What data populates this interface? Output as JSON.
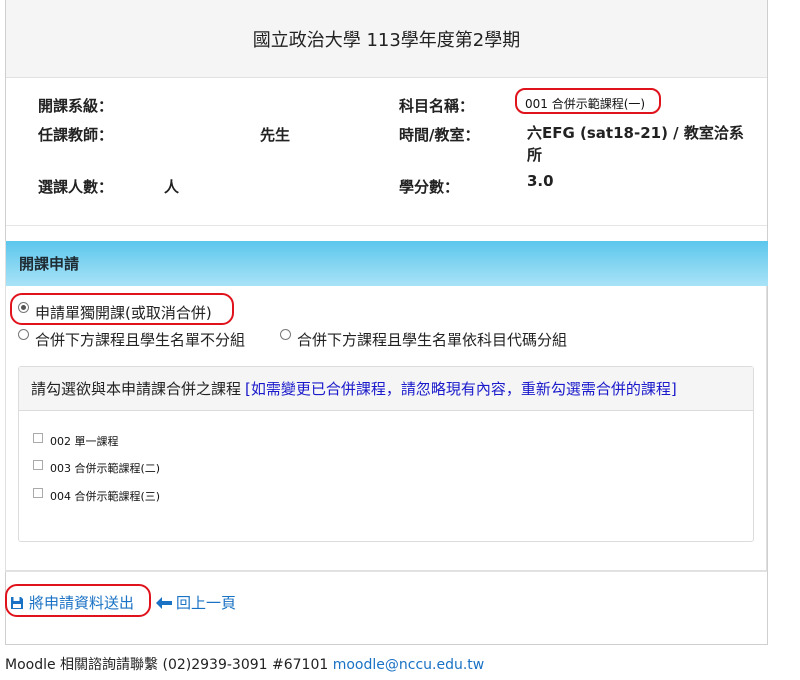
{
  "header": {
    "title": "國立政治大學 113學年度第2學期"
  },
  "info": {
    "department_label": "開課系級：",
    "department_value": "",
    "course_name_label": "科目名稱：",
    "course_name_value": "001 合併示範課程(一)",
    "teacher_label": "任課教師：",
    "teacher_value": "先生",
    "time_room_label": "時間/教室：",
    "time_room_value": "六EFG (sat18-21) / 教室洽系所",
    "enrollment_label": "選課人數：",
    "enrollment_value": "人",
    "credits_label": "學分數：",
    "credits_value": "3.0"
  },
  "apply_panel": {
    "heading": "開課申請",
    "options": [
      {
        "label": "申請單獨開課(或取消合併)",
        "checked": true
      },
      {
        "label": "合併下方課程且學生名單不分組",
        "checked": false
      },
      {
        "label": "合併下方課程且學生名單依科目代碼分組",
        "checked": false
      }
    ]
  },
  "merge_box": {
    "heading": "請勾選欲與本申請課合併之課程",
    "note": "[如需變更已合併課程，請忽略現有內容，重新勾選需合併的課程]",
    "courses": [
      {
        "label": "002 單一課程",
        "checked": false
      },
      {
        "label": "003 合併示範課程(二)",
        "checked": false
      },
      {
        "label": "004 合併示範課程(三)",
        "checked": false
      }
    ]
  },
  "actions": {
    "submit_label": "將申請資料送出",
    "back_label": "回上一頁"
  },
  "footer": {
    "text": "Moodle 相關諮詢請聯繫 (02)2939-3091 #67101 ",
    "email": "moodle@nccu.edu.tw"
  },
  "colors": {
    "highlight": "#e0121c",
    "link": "#1a72c4",
    "note": "#1a1acc",
    "panel_heading_top": "#5cc6ec",
    "panel_heading_bottom": "#a9e3f7"
  }
}
